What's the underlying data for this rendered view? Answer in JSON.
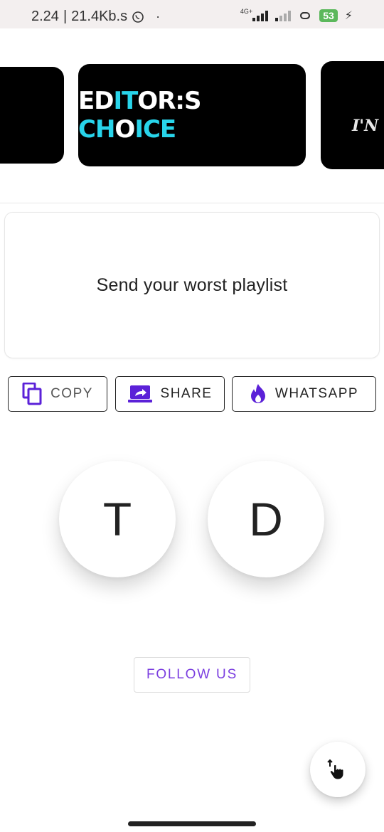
{
  "status_bar": {
    "time": "2.24",
    "separator": "|",
    "speed": "21.4Kb.s",
    "dot": "·",
    "network_type": "4G+",
    "battery": "53"
  },
  "carousel": {
    "banner_part1": "ED",
    "banner_part2": "IT",
    "banner_part3": "OR:S ",
    "banner_part4": "CH",
    "banner_part5": "O",
    "banner_part6": "ICE",
    "right_partial": "I'N"
  },
  "message": {
    "text": "Send your worst playlist"
  },
  "actions": {
    "copy_label": "COPY",
    "share_label": "SHARE",
    "whatsapp_label": "WHATSAPP"
  },
  "avatars": [
    {
      "initial": "T"
    },
    {
      "initial": "D"
    }
  ],
  "follow": {
    "label": "FOLLOW US"
  },
  "colors": {
    "accent_purple": "#7b3ee0",
    "icon_purple": "#5b21d8",
    "banner_cyan": "#28d4ea",
    "battery_green": "#5cb85c"
  },
  "icons": {
    "copy": "copy-icon",
    "share": "share-icon",
    "whatsapp": "flame-icon",
    "fab": "swipe-hand-icon"
  }
}
